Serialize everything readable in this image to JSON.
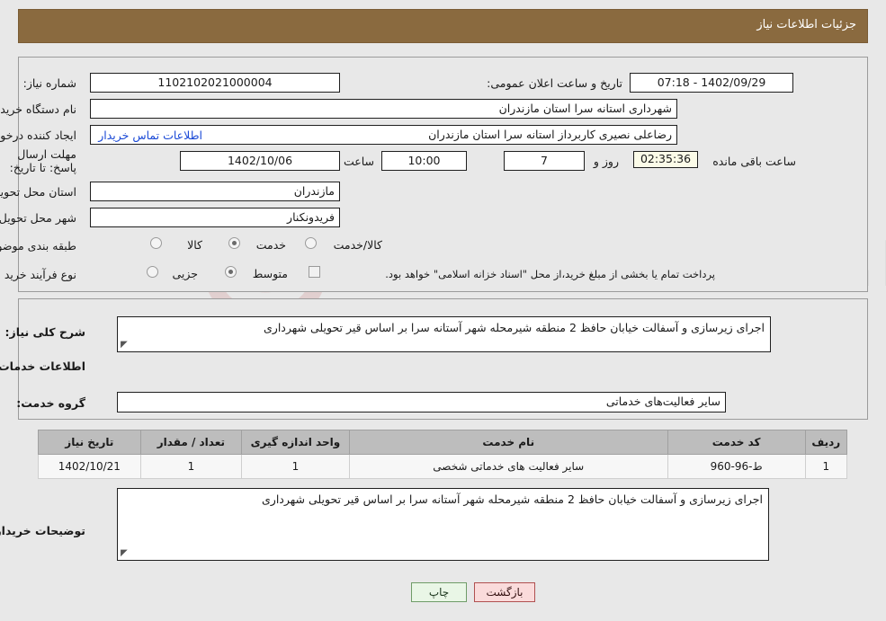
{
  "header": {
    "title": "جزئیات اطلاعات نیاز"
  },
  "top": {
    "need_number_label": "شماره نیاز:",
    "need_number_value": "1102102021000004",
    "announce_label": "تاریخ و ساعت اعلان عمومی:",
    "announce_value": "1402/09/29 - 07:18",
    "buyer_org_label": "نام دستگاه خریدار:",
    "buyer_org_value": "شهرداری استانه سرا استان مازندران",
    "creator_label": "ایجاد کننده درخواست:",
    "creator_value": "رضاعلی نصیری کاربرداز استانه سرا استان مازندران",
    "contact_link": "اطلاعات تماس خریدار",
    "deadline_label": "مهلت ارسال پاسخ: تا تاریخ:",
    "deadline_date": "1402/10/06",
    "hour_label": "ساعت",
    "deadline_time": "10:00",
    "days_value": "7",
    "days_and_label": "روز و",
    "countdown_value": "02:35:36",
    "remaining_label": "ساعت باقی مانده",
    "province_label": "استان محل تحویل:",
    "province_value": "مازندران",
    "city_label": "شهر محل تحویل:",
    "city_value": "فریدونکنار",
    "category_label": "طبقه بندی موضوعی:",
    "category_options": [
      "کالا",
      "خدمت",
      "کالا/خدمت"
    ],
    "category_selected": "خدمت",
    "process_label": "نوع فرآیند خرید :",
    "process_options": [
      "جزیی",
      "متوسط"
    ],
    "process_selected": "متوسط",
    "treasury_note": "پرداخت تمام یا بخشی از مبلغ خرید،از محل \"اسناد خزانه اسلامی\" خواهد بود."
  },
  "middle": {
    "general_desc_label": "شرح کلی نیاز:",
    "general_desc_value": "اجرای زیرسازی و آسفالت خیابان حافظ 2 منطقه شیرمحله شهر آستانه سرا بر اساس قیر تحویلی شهرداری",
    "section_title": "اطلاعات خدمات مورد نیاز",
    "service_group_label": "گروه خدمت:",
    "service_group_value": "سایر فعالیت‌های خدماتی"
  },
  "table": {
    "headers": [
      "ردیف",
      "کد خدمت",
      "نام خدمت",
      "واحد اندازه گیری",
      "تعداد / مقدار",
      "تاریخ نیاز"
    ],
    "rows": [
      {
        "row_no": "1",
        "service_code": "ط-96-960",
        "service_name": "سایر فعالیت های خدماتی شخصی",
        "unit": "1",
        "quantity": "1",
        "need_date": "1402/10/21"
      }
    ]
  },
  "bottom": {
    "buyer_notes_label": "توضیحات خریدار:",
    "buyer_notes_value": "اجرای زیرسازی و آسفالت خیابان حافظ 2 منطقه شیرمحله شهر آستانه سرا بر اساس قیر تحویلی شهرداری",
    "print_button": "چاپ",
    "back_button": "بازگشت"
  },
  "watermark": {
    "text": "AriaTender.net"
  },
  "colors": {
    "header_bg": "#8a6a3f",
    "link": "#1a49d6",
    "print_bg": "#e9f6e6",
    "back_bg": "#fadbdb",
    "table_header_bg": "#bdbdbd"
  }
}
